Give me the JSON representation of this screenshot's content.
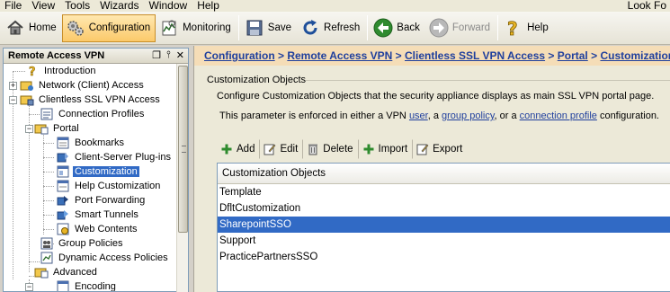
{
  "menu": {
    "items": [
      "File",
      "View",
      "Tools",
      "Wizards",
      "Window",
      "Help"
    ],
    "right_text": "Look Fo"
  },
  "toolbar": {
    "home": "Home",
    "configuration": "Configuration",
    "monitoring": "Monitoring",
    "save": "Save",
    "refresh": "Refresh",
    "back": "Back",
    "forward": "Forward",
    "help": "Help"
  },
  "left_panel": {
    "title": "Remote Access VPN",
    "tree": [
      {
        "label": "Introduction",
        "icon": "help-icon"
      },
      {
        "label": "Network (Client) Access",
        "icon": "network-folder-icon"
      },
      {
        "label": "Clientless SSL VPN Access",
        "icon": "ssl-folder-icon"
      },
      {
        "label": "Connection Profiles",
        "icon": "profiles-icon"
      },
      {
        "label": "Portal",
        "icon": "portal-folder-icon"
      },
      {
        "label": "Bookmarks",
        "icon": "bookmarks-icon"
      },
      {
        "label": "Client-Server Plug-ins",
        "icon": "plugin-icon"
      },
      {
        "label": "Customization",
        "icon": "customization-icon",
        "selected": true
      },
      {
        "label": "Help Customization",
        "icon": "help-customization-icon"
      },
      {
        "label": "Port Forwarding",
        "icon": "port-forwarding-icon"
      },
      {
        "label": "Smart Tunnels",
        "icon": "smart-tunnels-icon"
      },
      {
        "label": "Web Contents",
        "icon": "web-contents-icon"
      },
      {
        "label": "Group Policies",
        "icon": "group-policies-icon"
      },
      {
        "label": "Dynamic Access Policies",
        "icon": "dynamic-access-icon"
      },
      {
        "label": "Advanced",
        "icon": "advanced-folder-icon"
      },
      {
        "label": "Encoding",
        "icon": "encoding-icon"
      }
    ]
  },
  "breadcrumb": {
    "items": [
      "Configuration",
      "Remote Access VPN",
      "Clientless SSL VPN Access",
      "Portal",
      "Customization"
    ],
    "separator": ">"
  },
  "main": {
    "section_title": "Customization Objects",
    "description": "Configure Customization Objects that the security appliance displays as main SSL VPN portal page.",
    "enforced_prefix": "This parameter is enforced in either a VPN ",
    "link_user": "user",
    "sep1": ", a ",
    "link_group_policy": "group policy",
    "sep2": ", or a ",
    "link_connection_profile": "connection profile",
    "enforced_suffix": " configuration.",
    "actions": {
      "add": "Add",
      "edit": "Edit",
      "delete": "Delete",
      "import": "Import",
      "export": "Export"
    },
    "table": {
      "header": "Customization Objects",
      "rows": [
        "Template",
        "DfltCustomization",
        "SharepointSSO",
        "Support",
        "PracticePartnersSSO"
      ],
      "selected_index": 2
    }
  },
  "colors": {
    "selection": "#316ac5",
    "breadcrumb_bg": "#f5ddb7",
    "link": "#1f3f9d",
    "active_toolbar": "#fbc96a"
  }
}
